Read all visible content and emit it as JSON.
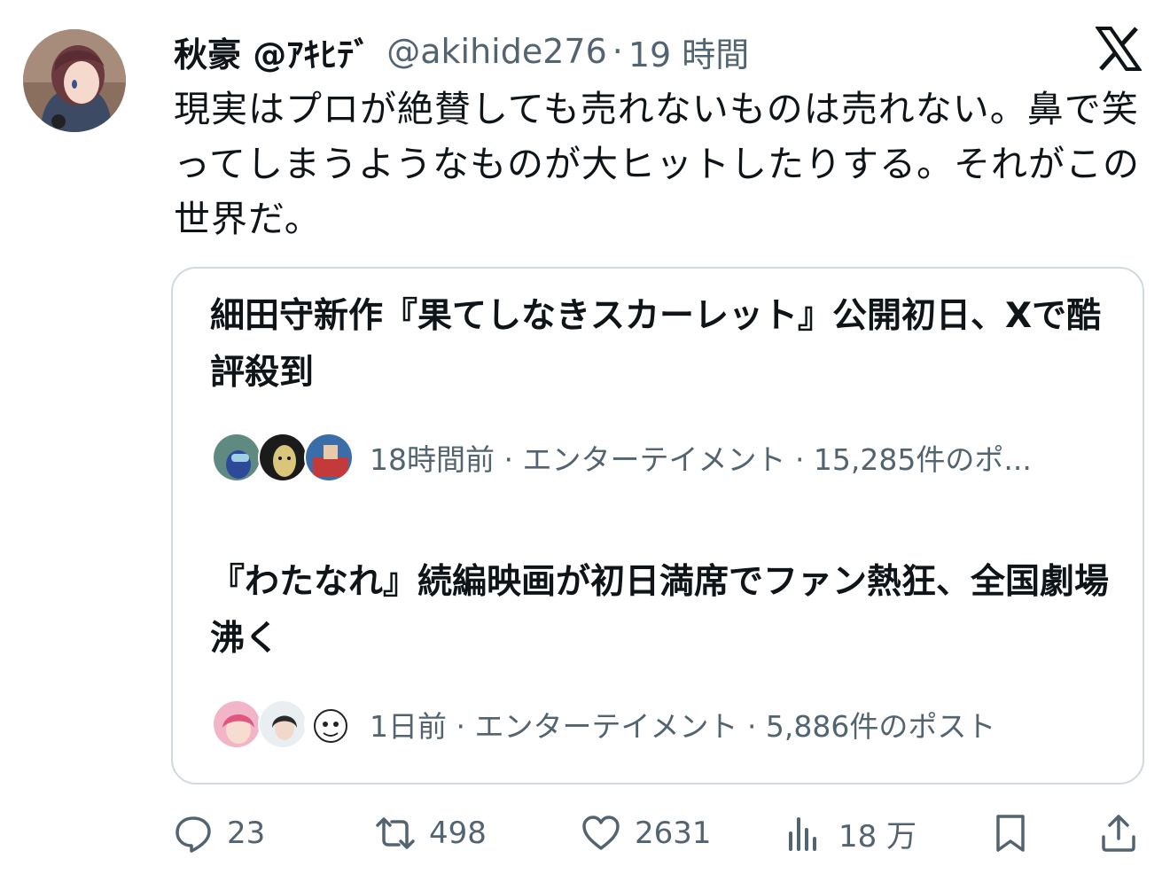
{
  "tweet": {
    "display_name": "秋豪 @ｱｷﾋﾃﾞ",
    "handle": "@akihide276",
    "separator": "·",
    "time": "19 時間",
    "text": "現実はプロが絶賛しても売れないものは売れない。鼻で笑ってしまうようなものが大ヒットしたりする。それがこの世界だ。"
  },
  "icons": {
    "logo": "x-logo-icon",
    "reply": "reply-icon",
    "retweet": "retweet-icon",
    "like": "heart-icon",
    "views": "views-icon",
    "bookmark": "bookmark-icon",
    "share": "share-icon"
  },
  "card": {
    "trends": [
      {
        "title": "細田守新作『果てしなきスカーレット』公開初日、Xで酷評殺到",
        "meta": "18時間前 · エンターテイメント · 15,285件のポ..."
      },
      {
        "title": "『わたなれ』続編映画が初日満席でファン熱狂、全国劇場沸く",
        "meta": "1日前 · エンターテイメント · 5,886件のポスト"
      }
    ]
  },
  "actions": {
    "replies": "23",
    "retweets": "498",
    "likes": "2631",
    "views": "18 万"
  },
  "colors": {
    "text": "#0f1419",
    "muted": "#536471",
    "border": "#cfd9de",
    "background": "#ffffff"
  }
}
